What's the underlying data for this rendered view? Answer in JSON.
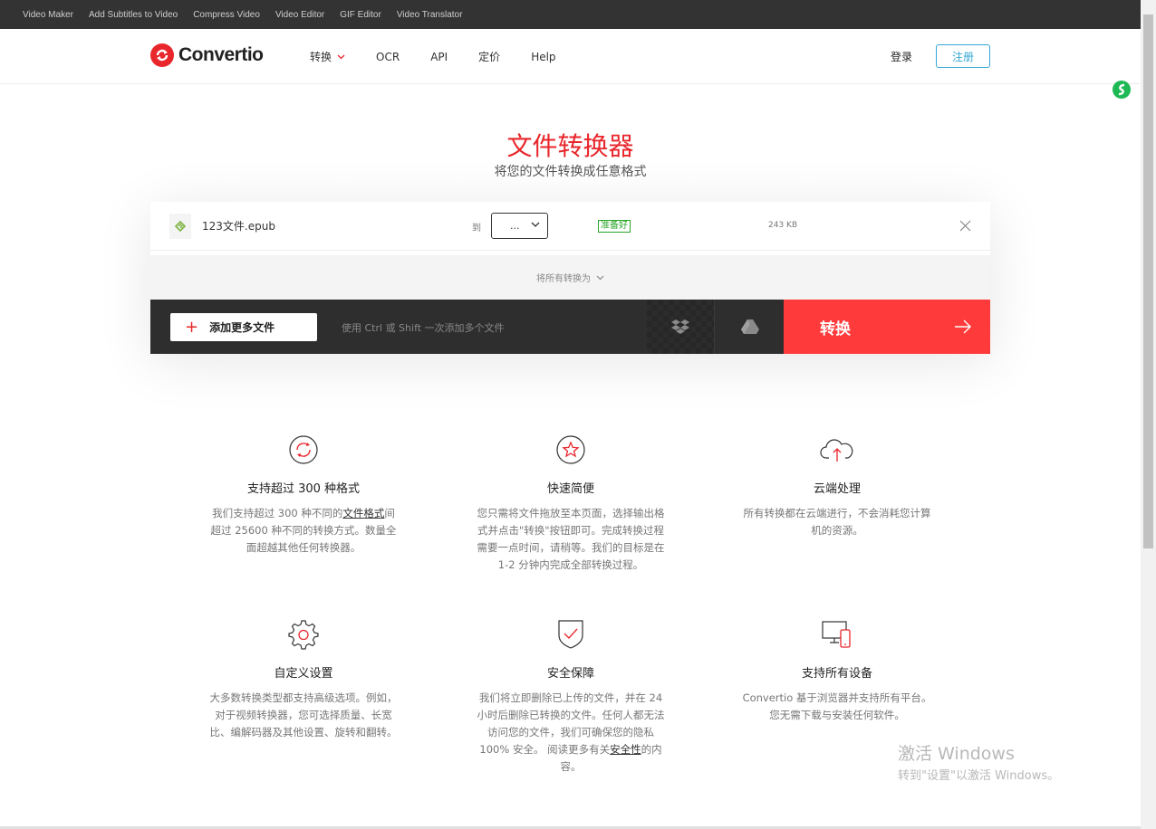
{
  "topbar": {
    "links": [
      "Video Maker",
      "Add Subtitles to Video",
      "Compress Video",
      "Video Editor",
      "GIF Editor",
      "Video Translator"
    ]
  },
  "header": {
    "logo_text": "Convertio",
    "nav": [
      "转换",
      "OCR",
      "API",
      "定价",
      "Help"
    ],
    "login": "登录",
    "register": "注册"
  },
  "hero": {
    "title": "文件转换器",
    "subtitle": "将您的文件转换成任意格式"
  },
  "file": {
    "name": "123文件.epub",
    "to_label": "到",
    "format_value": "...",
    "status": "准备好",
    "size": "243 KB"
  },
  "convert_all_label": "将所有转换为",
  "actions": {
    "add_files": "添加更多文件",
    "hint": "使用 Ctrl 或 Shift 一次添加多个文件",
    "convert": "转换"
  },
  "features": [
    {
      "icon": "refresh-icon",
      "title": "支持超过 300 种格式",
      "desc_pre": "我们支持超过 300 种不同的",
      "desc_link": "文件格式",
      "desc_post": "间超过 25600 种不同的转换方式。数量全面超越其他任何转换器。"
    },
    {
      "icon": "star-icon",
      "title": "快速简便",
      "desc": "您只需将文件拖放至本页面，选择输出格式并点击\"转换\"按钮即可。完成转换过程需要一点时间，请稍等。我们的目标是在 1-2 分钟内完成全部转换过程。"
    },
    {
      "icon": "cloud-upload-icon",
      "title": "云端处理",
      "desc": "所有转换都在云端进行，不会消耗您计算机的资源。"
    },
    {
      "icon": "gear-icon",
      "title": "自定义设置",
      "desc": "大多数转换类型都支持高级选项。例如，对于视频转换器，您可选择质量、长宽比、编解码器及其他设置、旋转和翻转。"
    },
    {
      "icon": "shield-icon",
      "title": "安全保障",
      "desc_pre": "我们将立即删除已上传的文件，并在 24 小时后删除已转换的文件。任何人都无法访问您的文件，我们可确保您的隐私 100% 安全。 阅读更多有关",
      "desc_link": "安全性",
      "desc_post": "的内容。"
    },
    {
      "icon": "devices-icon",
      "title": "支持所有设备",
      "desc": "Convertio 基于浏览器并支持所有平台。您无需下载与安装任何软件。"
    }
  ],
  "watermark": {
    "line1": "激活 Windows",
    "line2": "转到\"设置\"以激活 Windows。"
  },
  "colors": {
    "brand_red": "#e8262b",
    "convert_red": "#ff3a3a",
    "register_blue": "#34a7d6",
    "ready_green": "#2aa52a"
  }
}
